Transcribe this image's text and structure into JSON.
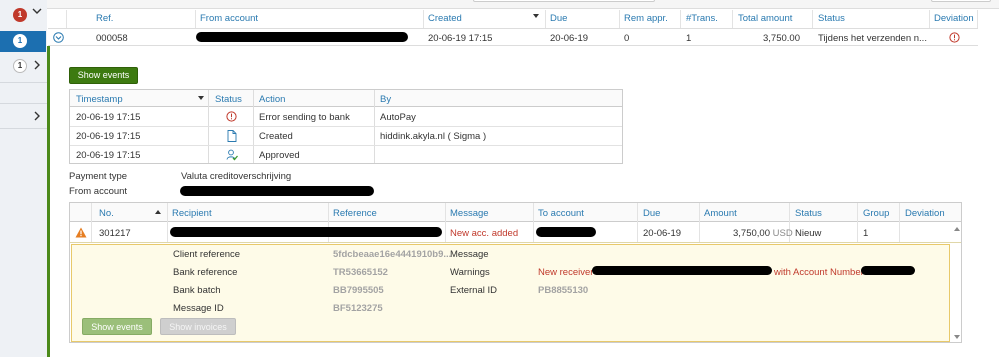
{
  "rail": {
    "badge_red": "1",
    "badge_active": "1",
    "badge_second": "1"
  },
  "batch_table": {
    "headers": {
      "ref": "Ref.",
      "from_account": "From account",
      "created": "Created",
      "due": "Due",
      "rem_appr": "Rem appr.",
      "trans": "#Trans.",
      "total_amount": "Total amount",
      "status": "Status",
      "deviation": "Deviation"
    },
    "row": {
      "ref": "000058",
      "created": "20-06-19 17:15",
      "due": "20-06-19",
      "rem_appr": "0",
      "trans": "1",
      "total_amount": "3,750.00",
      "status": "Tijdens het verzenden n..."
    }
  },
  "show_events_label": "Show events",
  "events_table": {
    "headers": {
      "timestamp": "Timestamp",
      "status": "Status",
      "action": "Action",
      "by": "By"
    },
    "rows": [
      {
        "timestamp": "20-06-19 17:15",
        "status_icon": "error-circle-icon",
        "action": "Error sending to bank",
        "by": "AutoPay"
      },
      {
        "timestamp": "20-06-19 17:15",
        "status_icon": "document-icon",
        "action": "Created",
        "by": "hiddink.akyla.nl ( Sigma )"
      },
      {
        "timestamp": "20-06-19 17:15",
        "status_icon": "user-approved-icon",
        "action": "Approved",
        "by": ""
      }
    ]
  },
  "payment_info": {
    "payment_type_label": "Payment type",
    "payment_type_value": "Valuta creditoverschrijving",
    "from_account_label": "From account"
  },
  "payments_table": {
    "headers": {
      "no": "No.",
      "recipient": "Recipient",
      "reference": "Reference",
      "message": "Message",
      "to_account": "To account",
      "due": "Due",
      "amount": "Amount",
      "status": "Status",
      "group": "Group",
      "deviation": "Deviation"
    },
    "row": {
      "no": "301217",
      "reference": "New acc. added",
      "due": "20-06-19",
      "amount": "3,750,00",
      "currency": "USD",
      "status": "Nieuw",
      "group": "1"
    },
    "detail": {
      "client_reference_label": "Client reference",
      "client_reference_value": "5fdcbeaae16e4441910b9...",
      "bank_reference_label": "Bank reference",
      "bank_reference_value": "TR53665152",
      "bank_batch_label": "Bank batch",
      "bank_batch_value": "BB7995505",
      "message_id_label": "Message ID",
      "message_id_value": "BF5123275",
      "message_label": "Message",
      "warnings_label": "Warnings",
      "warnings_prefix": "New receiver",
      "warnings_mid": "with Account Number",
      "external_id_label": "External ID",
      "external_id_value": "PB8855130",
      "show_events": "Show events",
      "show_invoices": "Show invoices"
    }
  },
  "colors": {
    "accent_blue": "#2a7ab0",
    "active_blue": "#1c6fb0",
    "green": "#3d7a10",
    "error_red": "#c0392b",
    "warning_orange": "#e67e22",
    "detail_bg": "#fefbe8"
  }
}
